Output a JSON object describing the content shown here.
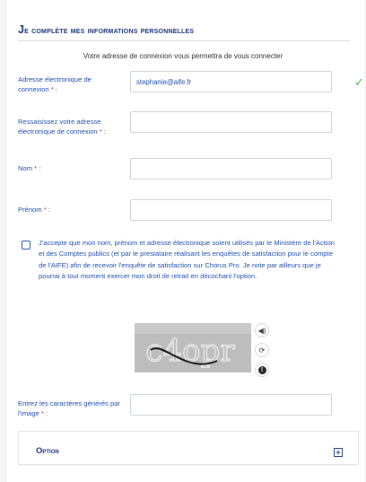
{
  "form": {
    "title_first": "J",
    "title_rest": "e complète mes informations personnelles",
    "intro": "Votre adresse de connexion vous permettra de vous connecter",
    "email": {
      "label": "Adresse électronique de connexion",
      "value": "stephanie@aife.fr",
      "required": "*"
    },
    "email_confirm": {
      "label": "Ressaisissez votre adresse électronique de connexion",
      "required": "*"
    },
    "nom": {
      "label": "Nom",
      "required": "*"
    },
    "prenom": {
      "label": "Prénom",
      "required": "*"
    },
    "consent": "J'accepte que mon nom, prénom et adresse électronique soient utilisés par le Ministère de l'Action et des Comptes publics (et par le prestataire réalisant les enquêtes de satisfaction pour le compte de l'AIFE) afin de recevoir l'enquête de satisfaction sur Chorus Pro. Je note par ailleurs que je pourrai à tout moment exercer mon droit de retrait en décochant l'option.",
    "captcha": {
      "text": "c4opr",
      "label": "Entrez les caractères générés par l'image",
      "required": "*"
    },
    "option": {
      "label_first": "O",
      "label_rest": "ption"
    }
  },
  "icons": {
    "valid": "check-icon",
    "audio": "speaker-icon",
    "refresh": "refresh-icon",
    "info": "info-icon",
    "expand": "plus-icon"
  },
  "colors": {
    "title": "#15327a",
    "label": "#1f4fb0",
    "required": "#d21f1f",
    "valid": "#4caf50"
  }
}
